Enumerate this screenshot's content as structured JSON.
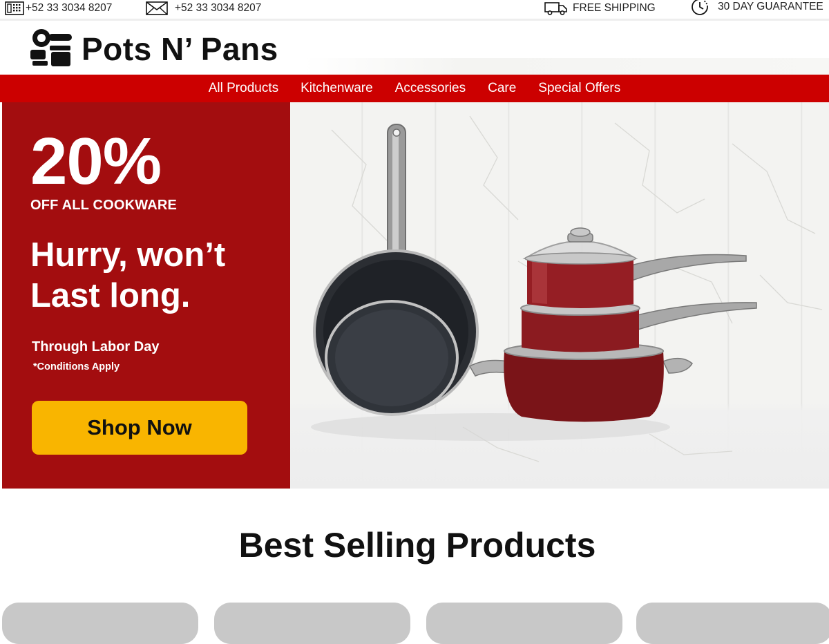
{
  "topbar": {
    "phone_icon": "phone-icon",
    "phone": "+52 33 3034 8207",
    "mail_icon": "envelope-icon",
    "email": "+52 33 3034 8207",
    "shipping_icon": "truck-icon",
    "shipping": "FREE SHIPPING",
    "guarantee_icon": "clock-icon",
    "guarantee": "30 DAY GUARANTEE"
  },
  "header": {
    "logo_icon": "pots-logo-icon",
    "logo_text": "Pots N’ Pans"
  },
  "nav": {
    "items": [
      {
        "label": "All Products"
      },
      {
        "label": "Kitchenware"
      },
      {
        "label": "Accessories"
      },
      {
        "label": "Care"
      },
      {
        "label": "Special Offers"
      }
    ]
  },
  "hero": {
    "percent": "20%",
    "subtitle": "OFF ALL COOKWARE",
    "headline": "Hurry, won’t Last long.",
    "period": "Through Labor Day",
    "conditions": "*Conditions Apply",
    "cta": "Shop Now",
    "colors": {
      "panel": "#a30d0f",
      "cta": "#f9b500",
      "nav": "#cc0000"
    }
  },
  "best_sellers": {
    "title": "Best Selling Products"
  }
}
